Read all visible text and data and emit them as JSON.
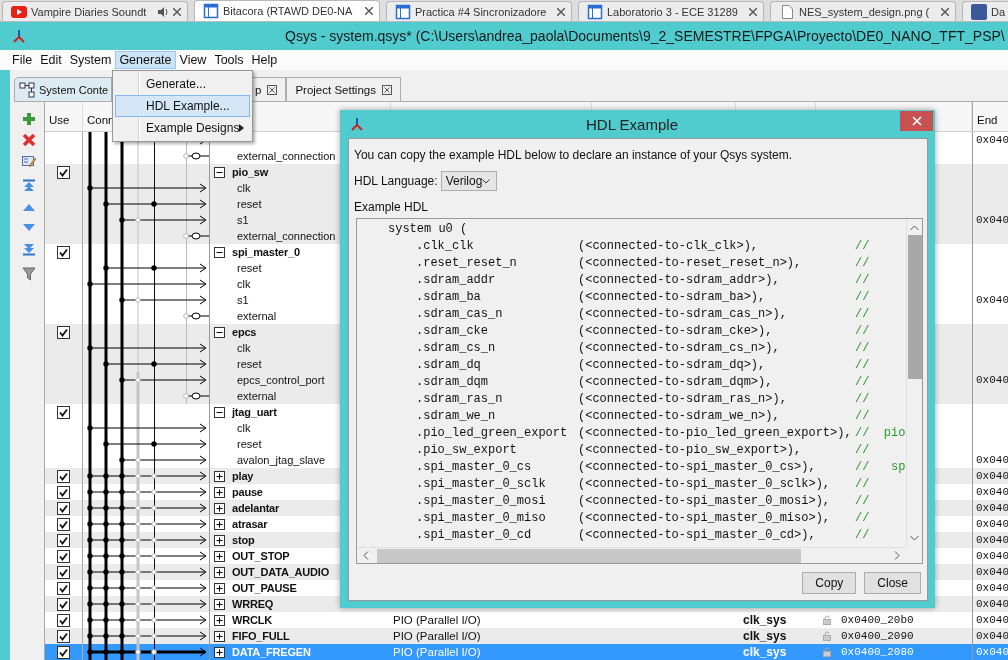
{
  "browser_tabs": [
    {
      "title": "Vampire Diaries Soundt",
      "kind": "video",
      "audio": true,
      "closable": true,
      "selected": false
    },
    {
      "title": "Bitacora (RTAWD DE0-NA",
      "kind": "page",
      "audio": false,
      "closable": true,
      "selected": true
    },
    {
      "title": "Practica #4 Sincronizadore",
      "kind": "page",
      "audio": false,
      "closable": true,
      "selected": false
    },
    {
      "title": "Laboratorio 3 - ECE 31289",
      "kind": "page",
      "audio": false,
      "closable": true,
      "selected": false
    },
    {
      "title": "NES_system_design.png (",
      "kind": "image",
      "audio": false,
      "closable": true,
      "selected": false
    },
    {
      "title": "Da",
      "kind": "social",
      "audio": false,
      "closable": false,
      "selected": false
    }
  ],
  "window": {
    "title": "Qsys - system.qsys* (C:\\Users\\andrea_paola\\Documents\\9_2_SEMESTRE\\FPGA\\Proyecto\\DE0_NANO_TFT_PSP\\"
  },
  "menu_bar": [
    {
      "label": "File",
      "selected": false
    },
    {
      "label": "Edit",
      "selected": false
    },
    {
      "label": "System",
      "selected": false
    },
    {
      "label": "Generate",
      "selected": true
    },
    {
      "label": "View",
      "selected": false
    },
    {
      "label": "Tools",
      "selected": false
    },
    {
      "label": "Help",
      "selected": false
    }
  ],
  "open_menu": {
    "items": [
      {
        "label": "Generate...",
        "selected": false,
        "submenu": false
      },
      {
        "label": "HDL Example...",
        "selected": true,
        "submenu": false
      },
      {
        "label": "Example Designs",
        "selected": false,
        "submenu": true
      }
    ]
  },
  "tabs": [
    {
      "label": "System Conte",
      "selected": true,
      "closable": false
    },
    {
      "label": "p",
      "selected": false,
      "closable": true
    },
    {
      "label": "Project Settings",
      "selected": false,
      "closable": true
    }
  ],
  "table": {
    "columns": {
      "use": "Use",
      "connections": "Conn",
      "end": "End"
    },
    "rows": [
      {
        "kind": "slave",
        "selected": false,
        "end": "0x040"
      },
      {
        "kind": "export",
        "name": "external_connection",
        "selected": false
      },
      {
        "kind": "component",
        "name": "pio_sw",
        "use": true,
        "expanded": true,
        "selected": false
      },
      {
        "kind": "clock",
        "name": "clk",
        "selected": false
      },
      {
        "kind": "reset",
        "name": "reset",
        "selected": false
      },
      {
        "kind": "slave",
        "name": "s1",
        "selected": false,
        "end": "0x040"
      },
      {
        "kind": "export",
        "name": "external_connection",
        "selected": false
      },
      {
        "kind": "component",
        "name": "spi_master_0",
        "use": true,
        "expanded": true,
        "selected": false
      },
      {
        "kind": "reset",
        "name": "reset",
        "selected": false
      },
      {
        "kind": "clock",
        "name": "clk",
        "selected": false
      },
      {
        "kind": "slave",
        "name": "s1",
        "selected": false,
        "end": "0x040"
      },
      {
        "kind": "export",
        "name": "external",
        "selected": false
      },
      {
        "kind": "component",
        "name": "epcs",
        "use": true,
        "expanded": true,
        "selected": false
      },
      {
        "kind": "clock",
        "name": "clk",
        "selected": false
      },
      {
        "kind": "reset",
        "name": "reset",
        "selected": false
      },
      {
        "kind": "slave",
        "name": "epcs_control_port",
        "selected": false,
        "end": "0x040"
      },
      {
        "kind": "export",
        "name": "external",
        "selected": false
      },
      {
        "kind": "component",
        "name": "jtag_uart",
        "use": true,
        "expanded": true,
        "selected": false
      },
      {
        "kind": "clock",
        "name": "clk",
        "selected": false
      },
      {
        "kind": "reset",
        "name": "reset",
        "selected": false
      },
      {
        "kind": "slave",
        "name": "avalon_jtag_slave",
        "selected": false,
        "end": "0x040"
      },
      {
        "kind": "component",
        "name": "play",
        "use": true,
        "expanded": false,
        "selected": false,
        "end": "0x040"
      },
      {
        "kind": "component",
        "name": "pause",
        "use": true,
        "expanded": false,
        "selected": false,
        "end": "0x040"
      },
      {
        "kind": "component",
        "name": "adelantar",
        "use": true,
        "expanded": false,
        "selected": false,
        "end": "0x040"
      },
      {
        "kind": "component",
        "name": "atrasar",
        "use": true,
        "expanded": false,
        "selected": false,
        "end": "0x040"
      },
      {
        "kind": "component",
        "name": "stop",
        "use": true,
        "expanded": false,
        "selected": false,
        "end": "0x040"
      },
      {
        "kind": "component",
        "name": "OUT_STOP",
        "use": true,
        "expanded": false,
        "selected": false,
        "end": "0x040"
      },
      {
        "kind": "component",
        "name": "OUT_DATA_AUDIO",
        "use": true,
        "expanded": false,
        "selected": false,
        "end": "0x040"
      },
      {
        "kind": "component",
        "name": "OUT_PAUSE",
        "use": true,
        "expanded": false,
        "selected": false,
        "end": "0x040"
      },
      {
        "kind": "component",
        "name": "WRREQ",
        "use": true,
        "expanded": false,
        "selected": false,
        "end": "0x040"
      },
      {
        "kind": "component",
        "name": "WRCLK",
        "use": true,
        "expanded": false,
        "selected": false,
        "description": "PIO (Parallel I/O)",
        "clock": "clk_sys",
        "base": "0x0400_20b0",
        "end": "0x040"
      },
      {
        "kind": "component",
        "name": "FIFO_FULL",
        "use": true,
        "expanded": false,
        "selected": false,
        "description": "PIO (Parallel I/O)",
        "clock": "clk_sys",
        "base": "0x0400_2090",
        "end": "0x040"
      },
      {
        "kind": "component",
        "name": "DATA_FREGEN",
        "use": true,
        "expanded": false,
        "selected": true,
        "description": "PIO (Parallel I/O)",
        "clock": "clk_sys",
        "base": "0x0400_2080",
        "end": "0x040"
      }
    ]
  },
  "dialog": {
    "title": "HDL Example",
    "intro": "You can copy the example HDL below to declare an instance of your Qsys system.",
    "language_label": "HDL Language:",
    "language": "Verilog",
    "code_label": "Example HDL",
    "code_header": "system u0 (",
    "ports": [
      {
        "name": ".clk_clk",
        "connection": "(<connected-to-clk_clk>),",
        "comment": "//"
      },
      {
        "name": ".reset_reset_n",
        "connection": "(<connected-to-reset_reset_n>),",
        "comment": "//"
      },
      {
        "name": ".sdram_addr",
        "connection": "(<connected-to-sdram_addr>),",
        "comment": "//"
      },
      {
        "name": ".sdram_ba",
        "connection": "(<connected-to-sdram_ba>),",
        "comment": "//"
      },
      {
        "name": ".sdram_cas_n",
        "connection": "(<connected-to-sdram_cas_n>),",
        "comment": "//"
      },
      {
        "name": ".sdram_cke",
        "connection": "(<connected-to-sdram_cke>),",
        "comment": "//"
      },
      {
        "name": ".sdram_cs_n",
        "connection": "(<connected-to-sdram_cs_n>),",
        "comment": "//"
      },
      {
        "name": ".sdram_dq",
        "connection": "(<connected-to-sdram_dq>),",
        "comment": "//"
      },
      {
        "name": ".sdram_dqm",
        "connection": "(<connected-to-sdram_dqm>),",
        "comment": "//"
      },
      {
        "name": ".sdram_ras_n",
        "connection": "(<connected-to-sdram_ras_n>),",
        "comment": "//"
      },
      {
        "name": ".sdram_we_n",
        "connection": "(<connected-to-sdram_we_n>),",
        "comment": "//"
      },
      {
        "name": ".pio_led_green_export",
        "connection": "(<connected-to-pio_led_green_export>),",
        "comment": "//  pio"
      },
      {
        "name": ".pio_sw_export",
        "connection": "(<connected-to-pio_sw_export>),",
        "comment": "//"
      },
      {
        "name": ".spi_master_0_cs",
        "connection": "(<connected-to-spi_master_0_cs>),",
        "comment": "//   sp"
      },
      {
        "name": ".spi_master_0_sclk",
        "connection": "(<connected-to-spi_master_0_sclk>),",
        "comment": "//"
      },
      {
        "name": ".spi_master_0_mosi",
        "connection": "(<connected-to-spi_master_0_mosi>),",
        "comment": "//"
      },
      {
        "name": ".spi_master_0_miso",
        "connection": "(<connected-to-spi_master_0_miso>),",
        "comment": "//"
      },
      {
        "name": ".spi_master_0_cd",
        "connection": "(<connected-to-spi_master_0_cd>),",
        "comment": "//"
      }
    ],
    "buttons": [
      "Copy",
      "Close"
    ]
  }
}
